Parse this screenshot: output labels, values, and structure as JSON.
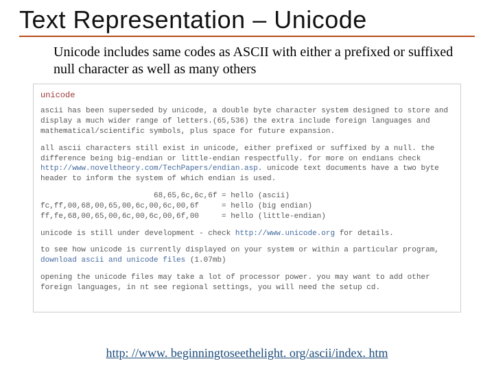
{
  "title": "Text Representation – Unicode",
  "subtitle": "Unicode includes same codes as ASCII with either a prefixed or suffixed null character as well as many others",
  "clip": {
    "heading": "unicode",
    "p1a": "ascii has been superseded by unicode, a double byte character system designed to store and display a much wider range of letters.(65,536) the extra include foreign languages and mathematical/scientific symbols, plus space for future expansion.",
    "p2a": "all ascii characters still exist in unicode, either prefixed or suffixed by a null. the difference being big-endian or little-endian respectfully. for more on endians check ",
    "p2link": "http://www.noveltheory.com/TechPapers/endian.asp",
    "p2b": ". unicode text documents have a two byte header to inform the system of which endian is used.",
    "ex1l": "                         68,65,6c,6c,6f",
    "ex1r": "hello (ascii)",
    "ex2l": "fc,ff,00,68,00,65,00,6c,00,6c,00,6f",
    "ex2r": "hello (big endian)",
    "ex3l": "ff,fe,68,00,65,00,6c,00,6c,00,6f,00",
    "ex3r": "hello (little-endian)",
    "p3a": "unicode is still under development - check ",
    "p3link": "http://www.unicode.org",
    "p3b": " for details.",
    "p4a": "to see how unicode is currently displayed on your system or within a particular program, ",
    "p4link": "download ascii and unicode files",
    "p4b": " (1.07mb)",
    "p5": "opening the unicode files may take a lot of processor power. you may want to add other foreign languages, in nt see regional settings, you will need the setup cd."
  },
  "footer_url": "http: //www. beginningtoseethelight. org/ascii/index. htm"
}
